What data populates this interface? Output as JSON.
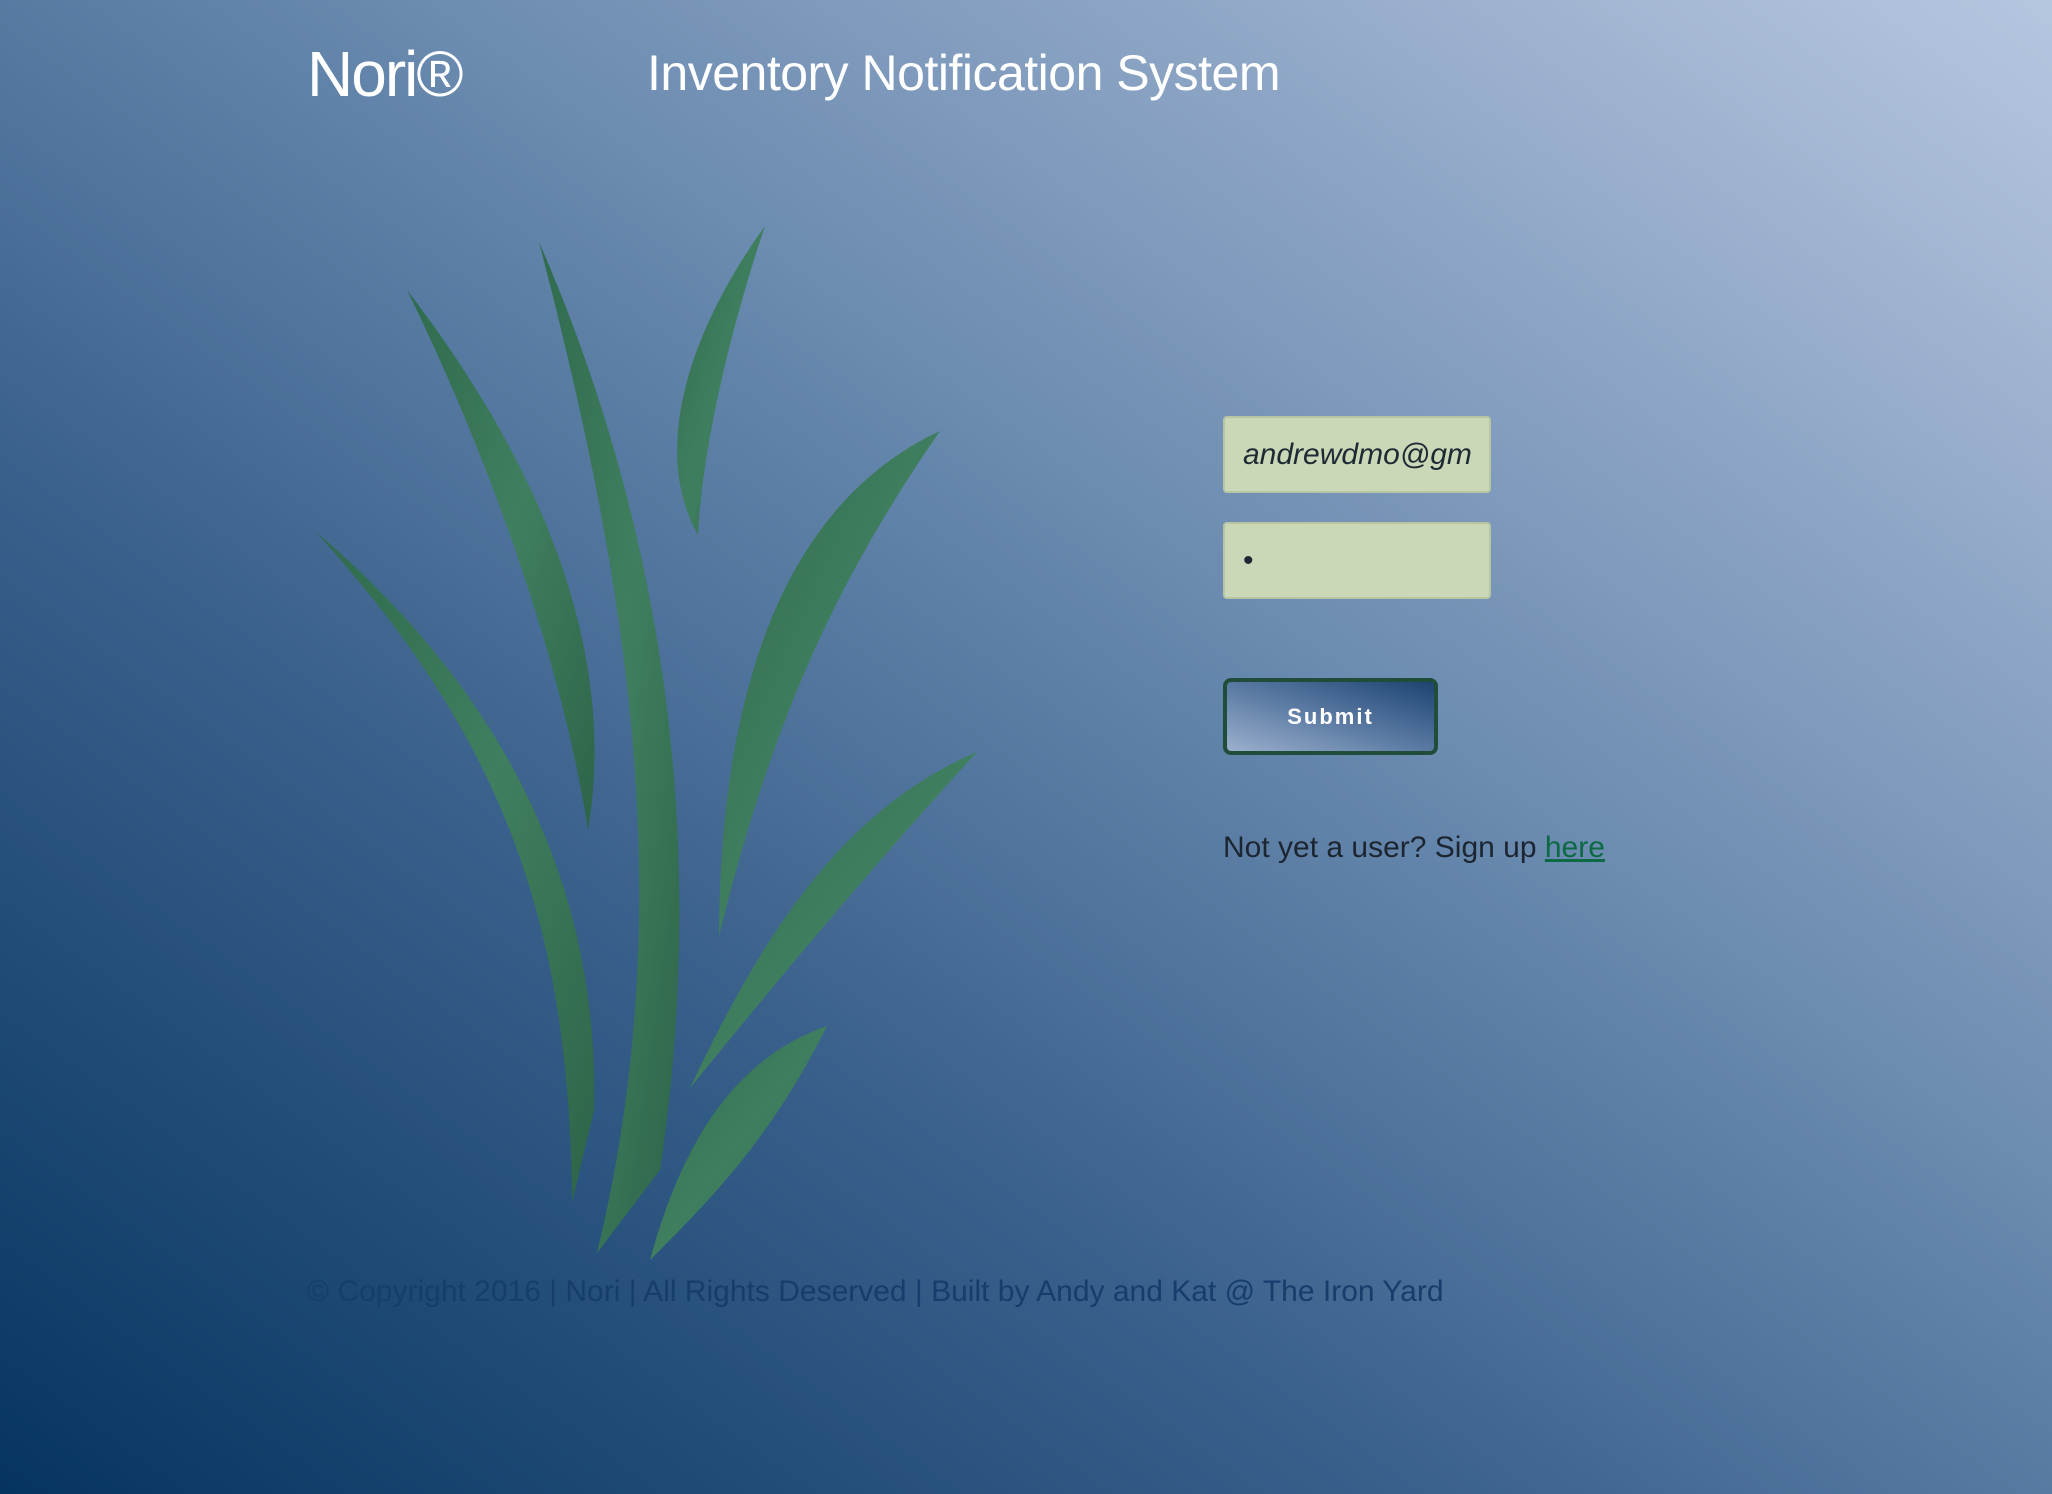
{
  "header": {
    "brand": "Nori®",
    "title": "Inventory Notification System"
  },
  "login": {
    "email_value": "andrewdmo@gmail.com",
    "password_value": "•",
    "submit_label": "Submit",
    "signup_prompt": "Not yet a user? Sign up ",
    "signup_link": "here"
  },
  "footer": {
    "text": "© Copyright 2016 | Nori | All Rights Deserved | Built by Andy and Kat @ The Iron Yard"
  },
  "colors": {
    "leaf": "#3f7a5c",
    "field_bg": "#cbd8b8",
    "link": "#0b6a43"
  }
}
